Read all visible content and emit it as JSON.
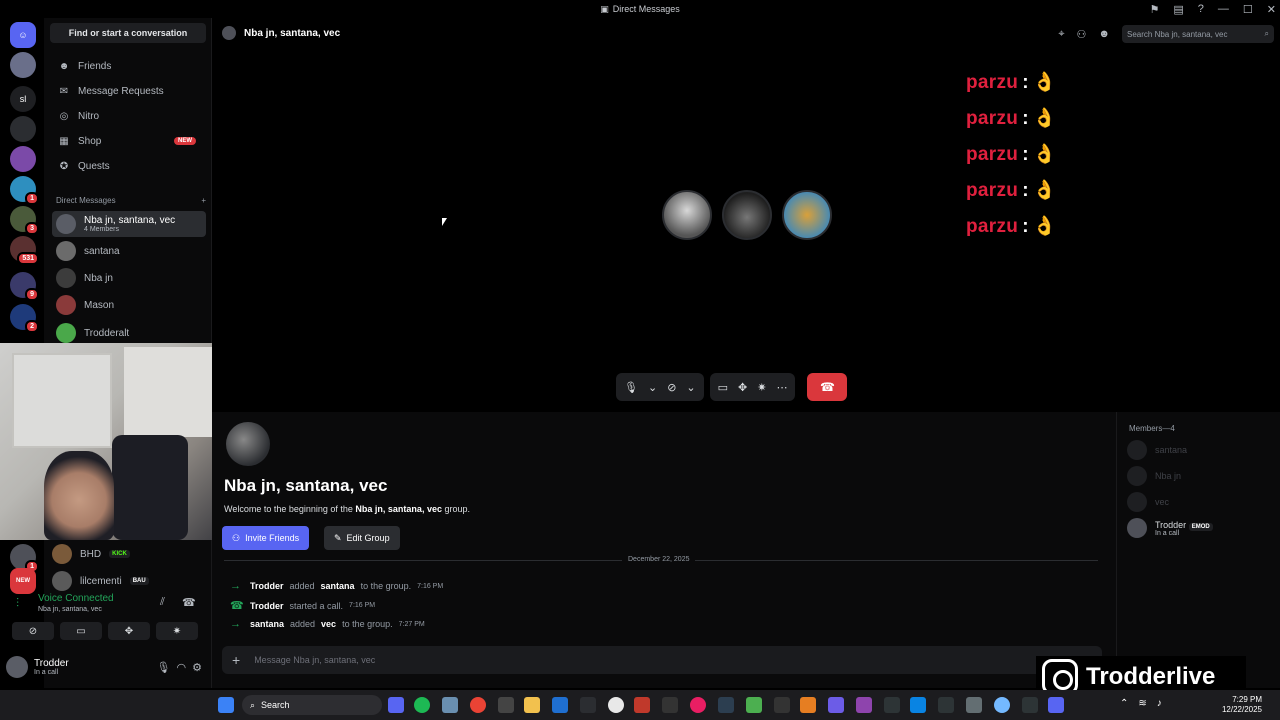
{
  "window": {
    "title": "Direct Messages"
  },
  "guilds": [
    {
      "label": "",
      "badge": ""
    },
    {
      "label": "",
      "badge": ""
    },
    {
      "label": "sl",
      "badge": ""
    },
    {
      "label": "",
      "badge": ""
    },
    {
      "label": "",
      "badge": ""
    },
    {
      "label": "",
      "badge": "1"
    },
    {
      "label": "",
      "badge": "3"
    },
    {
      "label": "",
      "badge": "531"
    },
    {
      "label": "",
      "badge": "9"
    },
    {
      "label": "",
      "badge": "2"
    }
  ],
  "guilds_lower": [
    {
      "badge": "1"
    },
    {
      "badge": "NEW"
    }
  ],
  "sidebar": {
    "find_placeholder": "Find or start a conversation",
    "nav": [
      {
        "label": "Friends",
        "icon": "friends-icon"
      },
      {
        "label": "Message Requests",
        "icon": "mail-icon"
      },
      {
        "label": "Nitro",
        "icon": "nitro-icon"
      },
      {
        "label": "Shop",
        "icon": "shop-icon",
        "badge": "NEW"
      },
      {
        "label": "Quests",
        "icon": "quests-icon"
      }
    ],
    "dm_header": "Direct Messages",
    "dms": [
      {
        "name": "Nba jn, santana, vec",
        "sub": "4 Members",
        "active": true
      },
      {
        "name": "santana"
      },
      {
        "name": "Nba jn"
      },
      {
        "name": "Mason"
      },
      {
        "name": "Trodderalt"
      }
    ],
    "lower_dms": [
      {
        "name": "BHD",
        "tag": "KICK"
      },
      {
        "name": "lilcementi",
        "tag": "BAU"
      }
    ],
    "voice": {
      "title": "Voice Connected",
      "sub": "Nba jn, santana, vec"
    },
    "user": {
      "name": "Trodder",
      "status": "In a call"
    }
  },
  "header": {
    "channel": "Nba jn, santana, vec",
    "search_placeholder": "Search Nba jn, santana, vec"
  },
  "overlay": {
    "line": "parzu",
    "sep": ":",
    "emoji": "👌"
  },
  "call": {
    "controls": [
      "mic",
      "camera",
      "screenshare",
      "activities",
      "soundboard",
      "more"
    ]
  },
  "chat": {
    "group_title": "Nba jn, santana, vec",
    "welcome_pre": "Welcome to the beginning of the ",
    "welcome_name": "Nba jn, santana, vec",
    "welcome_post": " group.",
    "invite_label": "Invite Friends",
    "edit_label": "Edit Group",
    "date": "December 22, 2025",
    "events": [
      {
        "actor": "Trodder",
        "mid": "added",
        "target": "santana",
        "rest": "to the group.",
        "time": "7:16 PM"
      },
      {
        "actor": "Trodder",
        "mid": "started a call.",
        "target": "",
        "rest": "",
        "time": "7:16 PM"
      },
      {
        "actor": "santana",
        "mid": "added",
        "target": "vec",
        "rest": "to the group.",
        "time": "7:27 PM"
      }
    ],
    "composer_placeholder": "Message Nba jn, santana, vec"
  },
  "members": {
    "header": "Members—4",
    "list": [
      {
        "name": "santana",
        "online": false
      },
      {
        "name": "Nba jn",
        "online": false
      },
      {
        "name": "vec",
        "online": false
      },
      {
        "name": "Trodder",
        "tag": "EMOD",
        "status": "In a call",
        "online": true
      }
    ]
  },
  "taskbar": {
    "search": "Search",
    "time": "7:29 PM",
    "date": "12/22/2025"
  },
  "watermark": {
    "handle": "Trodderlive"
  },
  "colors": {
    "accent": "#5865f2",
    "danger": "#da373c",
    "online": "#23a55a",
    "overlay_text": "#e0203e"
  }
}
